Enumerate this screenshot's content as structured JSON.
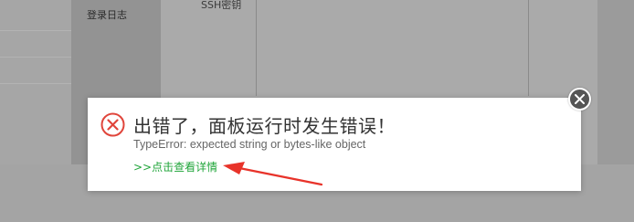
{
  "background": {
    "sidebar_item_label": "登录日志",
    "column_header": "SSH密钥"
  },
  "dialog": {
    "title": "出错了，面板运行时发生错误！",
    "message": "TypeError: expected string or bytes-like object",
    "details_link": ">>点击查看详情",
    "icon": "error-circle-x-icon",
    "close_icon": "close-icon"
  },
  "colors": {
    "error_red": "#e0453b",
    "link_green": "#20a53a",
    "close_button_bg": "#555555",
    "annotation_arrow": "#e8332a"
  }
}
